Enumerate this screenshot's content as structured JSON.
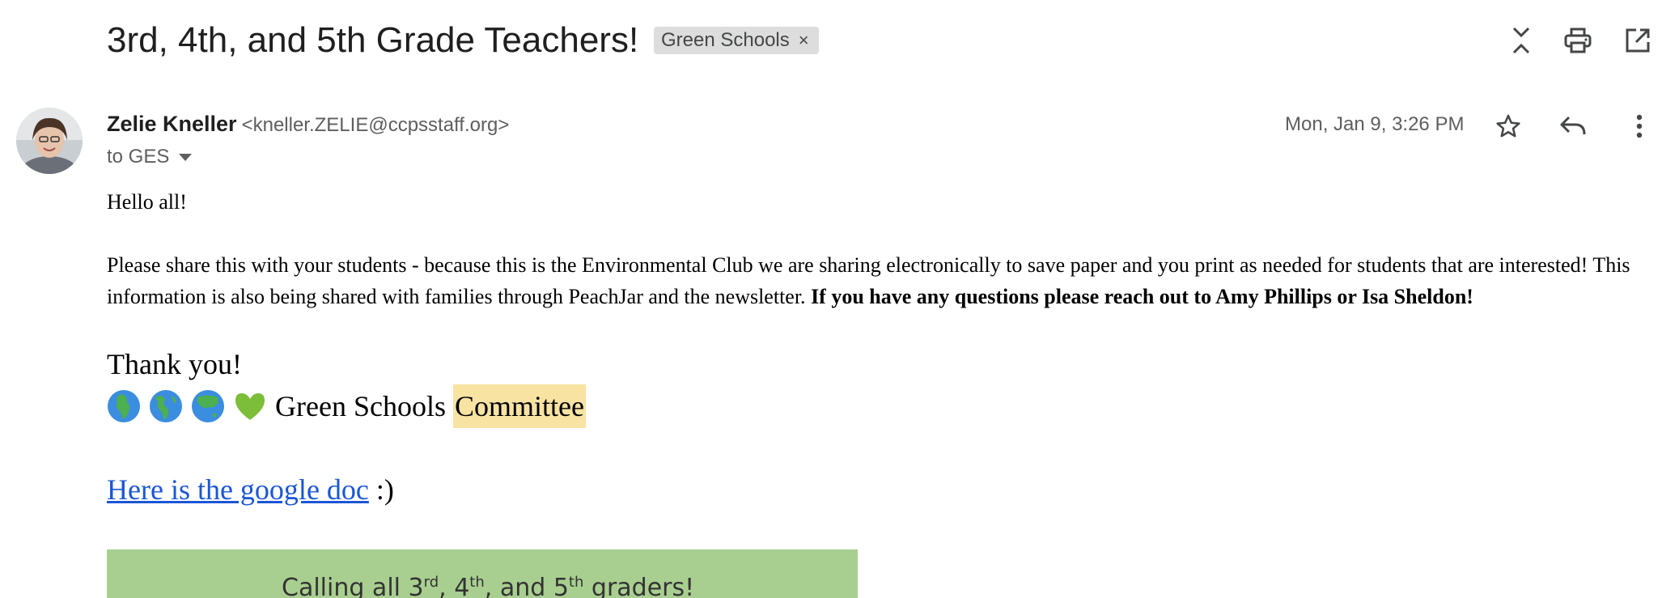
{
  "email": {
    "subject": "3rd, 4th, and 5th Grade Teachers!",
    "label_chip": {
      "text": "Green Schools",
      "remove_glyph": "×"
    },
    "toolbar": {
      "icons": [
        "collapse-all-icon",
        "print-icon",
        "open-new-window-icon"
      ]
    },
    "sender": {
      "name": "Zelie Kneller",
      "email": "<kneller.ZELIE@ccpsstaff.org>",
      "to_text": "to GES"
    },
    "date": "Mon, Jan 9, 3:26 PM",
    "actions": {
      "icons": [
        "star-icon",
        "reply-icon",
        "more-vert-icon"
      ]
    },
    "body": {
      "greeting": "Hello all!",
      "paragraph": "Please share this with your students - because this is the Environmental Club we are sharing electronically to save paper and you print as needed for students that are interested!  This information is also being shared with families through PeachJar and the newsletter. ",
      "paragraph_bold": "If you have any questions please reach out to Amy Phillips or Isa Sheldon!",
      "thanks": "Thank you!",
      "signature_emojis": [
        "globe-africa-icon",
        "globe-americas-icon",
        "globe-asia-icon",
        "green-heart-icon"
      ],
      "signature_text": "Green Schools",
      "signature_highlight": "Committee",
      "doc_link_text": "Here is the google doc",
      "doc_link_suffix": " :)"
    },
    "flyer": {
      "text_1": "Calling all 3",
      "sup_1": "rd",
      "text_2": ", 4",
      "sup_2": "th",
      "text_3": ", and 5",
      "sup_3": "th",
      "text_4": " graders!"
    }
  },
  "colors": {
    "link": "#1a56d6",
    "highlight": "#f8e3a3",
    "chip_bg": "#dddddd",
    "flyer_bg": "#a9cf90"
  }
}
